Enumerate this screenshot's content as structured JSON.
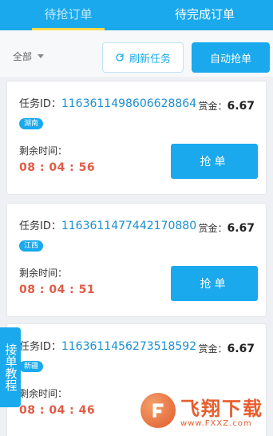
{
  "tabs": [
    {
      "label": "待抢订单"
    },
    {
      "label": "待完成订单"
    }
  ],
  "filter": {
    "label": "全部"
  },
  "actions": {
    "refresh_label": "刷新任务",
    "auto_label": "自动抢单"
  },
  "task_labels": {
    "id_prefix": "任务ID：",
    "reward_prefix": "赏金：",
    "remaining_label": "剩余时间：",
    "grab_label": "抢单"
  },
  "tasks": [
    {
      "id": "1163611498606628864",
      "reward": "6.67",
      "region": "湖南",
      "remaining": "08 : 04 : 56"
    },
    {
      "id": "1163611477442170880",
      "reward": "6.67",
      "region": "江西",
      "remaining": "08 : 04 : 51"
    },
    {
      "id": "1163611456273518592",
      "reward": "6.67",
      "region": "新疆",
      "remaining": "08 : 04 : 46"
    }
  ],
  "side_tab": {
    "label": "接单教程"
  },
  "watermark": {
    "title": "飞翔下载",
    "url": "www.FXXZ.com"
  },
  "colors": {
    "accent": "#1aa9ec",
    "timer": "#e25b45",
    "id_link": "#1a8fd0"
  }
}
